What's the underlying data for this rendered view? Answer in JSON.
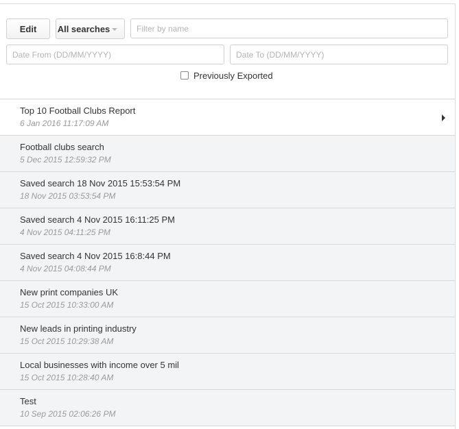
{
  "toolbar": {
    "edit_label": "Edit",
    "scope_label": "All searches"
  },
  "filters": {
    "name_placeholder": "Filter by name",
    "date_from_placeholder": "Date From (DD/MM/YYYY)",
    "date_to_placeholder": "Date To (DD/MM/YYYY)",
    "previously_exported_label": "Previously Exported",
    "previously_exported_checked": false
  },
  "searches": [
    {
      "title": "Top 10 Football Clubs Report",
      "date": "6 Jan 2016 11:17:09 AM",
      "selected": true
    },
    {
      "title": "Football clubs search",
      "date": "5 Dec 2015 12:59:32 PM"
    },
    {
      "title": "Saved search 18 Nov 2015 15:53:54 PM",
      "date": "18 Nov 2015 03:53:54 PM"
    },
    {
      "title": "Saved search 4 Nov 2015 16:11:25 PM",
      "date": "4 Nov 2015 04:11:25 PM"
    },
    {
      "title": "Saved search 4 Nov 2015 16:8:44 PM",
      "date": "4 Nov 2015 04:08:44 PM"
    },
    {
      "title": "New print companies UK",
      "date": "15 Oct 2015 10:33:00 AM"
    },
    {
      "title": "New leads in printing industry",
      "date": "15 Oct 2015 10:29:38 AM"
    },
    {
      "title": "Local businesses with income over 5 mil",
      "date": "15 Oct 2015 10:28:40 AM"
    },
    {
      "title": "Test",
      "date": "10 Sep 2015 02:06:26 PM"
    }
  ],
  "colors": {
    "selected_row": "#ffffff",
    "row": "#f3f4f6",
    "date_text": "#9a9a9a"
  },
  "icons": {
    "row_arrow": "caret-right-icon",
    "dropdown": "caret-down-icon"
  }
}
